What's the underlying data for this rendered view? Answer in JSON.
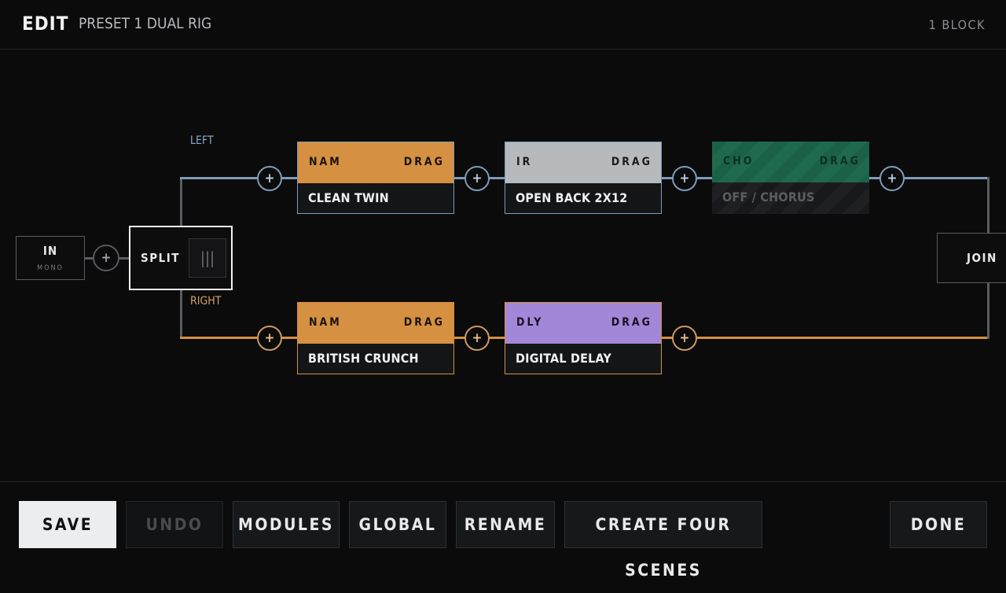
{
  "header": {
    "title": "EDIT",
    "preset": "PRESET 1  DUAL RIG",
    "block_count": "1 BLOCK"
  },
  "paths": {
    "left_label": "LEFT",
    "right_label": "RIGHT",
    "left_color": "#7d9bb8",
    "right_color": "#d59042"
  },
  "input": {
    "label": "IN",
    "sub": "MONO"
  },
  "split": {
    "label": "SPLIT",
    "handle_icon": "drag-handle-icon",
    "handle_glyph": "|||"
  },
  "join": {
    "label": "JOIN"
  },
  "add_glyph": "+",
  "blocks": [
    {
      "type": "NAM",
      "drag": "DRAG",
      "name": "CLEAN TWIN",
      "color": "#d59042"
    },
    {
      "type": "IR",
      "drag": "DRAG",
      "name": "OPEN BACK 2X12",
      "color": "#b6babd"
    },
    {
      "type": "CHO",
      "drag": "DRAG",
      "name": "OFF  /  CHORUS",
      "color": "#1f6a4f",
      "state": "bypassed"
    },
    {
      "type": "NAM",
      "drag": "DRAG",
      "name": "BRITISH CRUNCH",
      "color": "#d59042"
    },
    {
      "type": "DLY",
      "drag": "DRAG",
      "name": "DIGITAL DELAY",
      "color": "#a287d8"
    }
  ],
  "footer": {
    "save": "SAVE",
    "undo": "UNDO",
    "modules": "MODULES",
    "global": "GLOBAL",
    "rename": "RENAME",
    "create_scenes": "CREATE FOUR SCENES",
    "done": "DONE"
  }
}
